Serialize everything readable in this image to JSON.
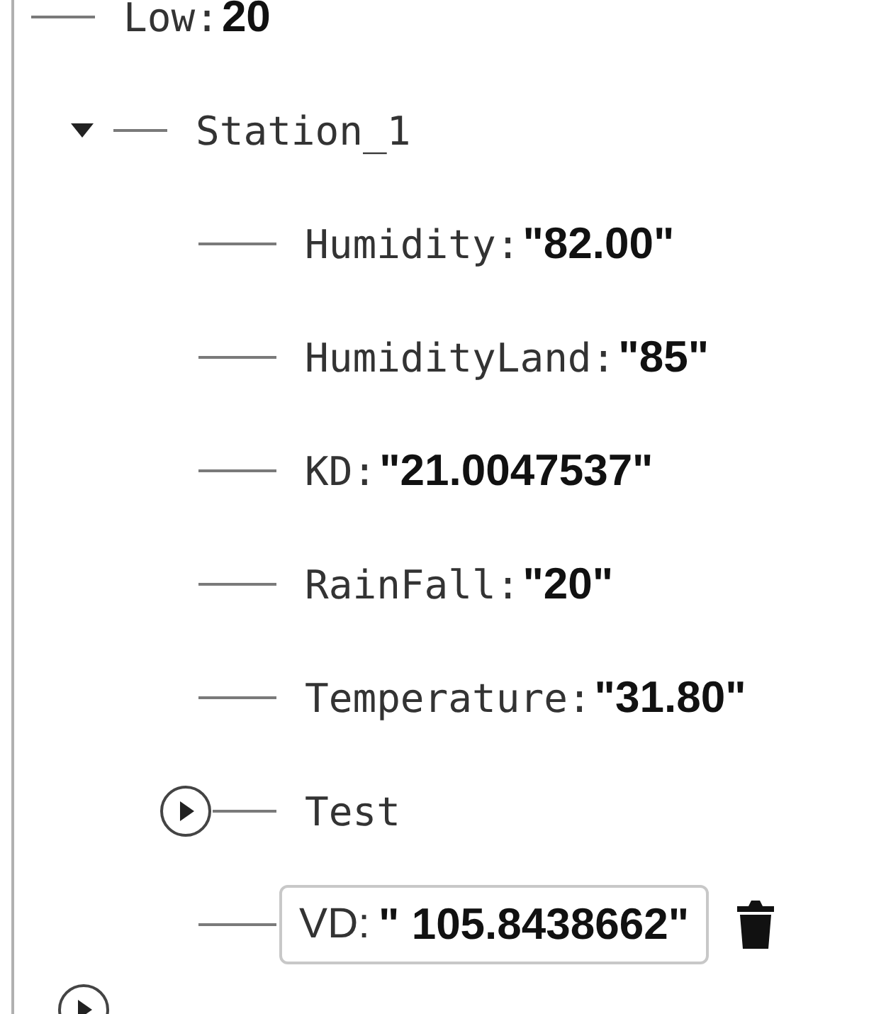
{
  "nodes": [
    {
      "key": "Low:",
      "value": "20",
      "kind": "leaf"
    },
    {
      "key": "Station_1",
      "kind": "branch",
      "expanded": true,
      "children": [
        {
          "key": "Humidity:",
          "value": "\"82.00\"",
          "kind": "leaf"
        },
        {
          "key": "HumidityLand:",
          "value": "\"85\"",
          "kind": "leaf"
        },
        {
          "key": "KD:",
          "value": "\"21.0047537\"",
          "kind": "leaf"
        },
        {
          "key": "RainFall:",
          "value": "\"20\"",
          "kind": "leaf"
        },
        {
          "key": "Temperature:",
          "value": "\"31.80\"",
          "kind": "leaf"
        },
        {
          "key": "Test",
          "kind": "branch",
          "expanded": false
        },
        {
          "key": "VD:",
          "value": "\" 105.8438662\"",
          "kind": "leaf",
          "editing": true
        }
      ]
    },
    {
      "kind": "branch",
      "expanded": false
    }
  ]
}
